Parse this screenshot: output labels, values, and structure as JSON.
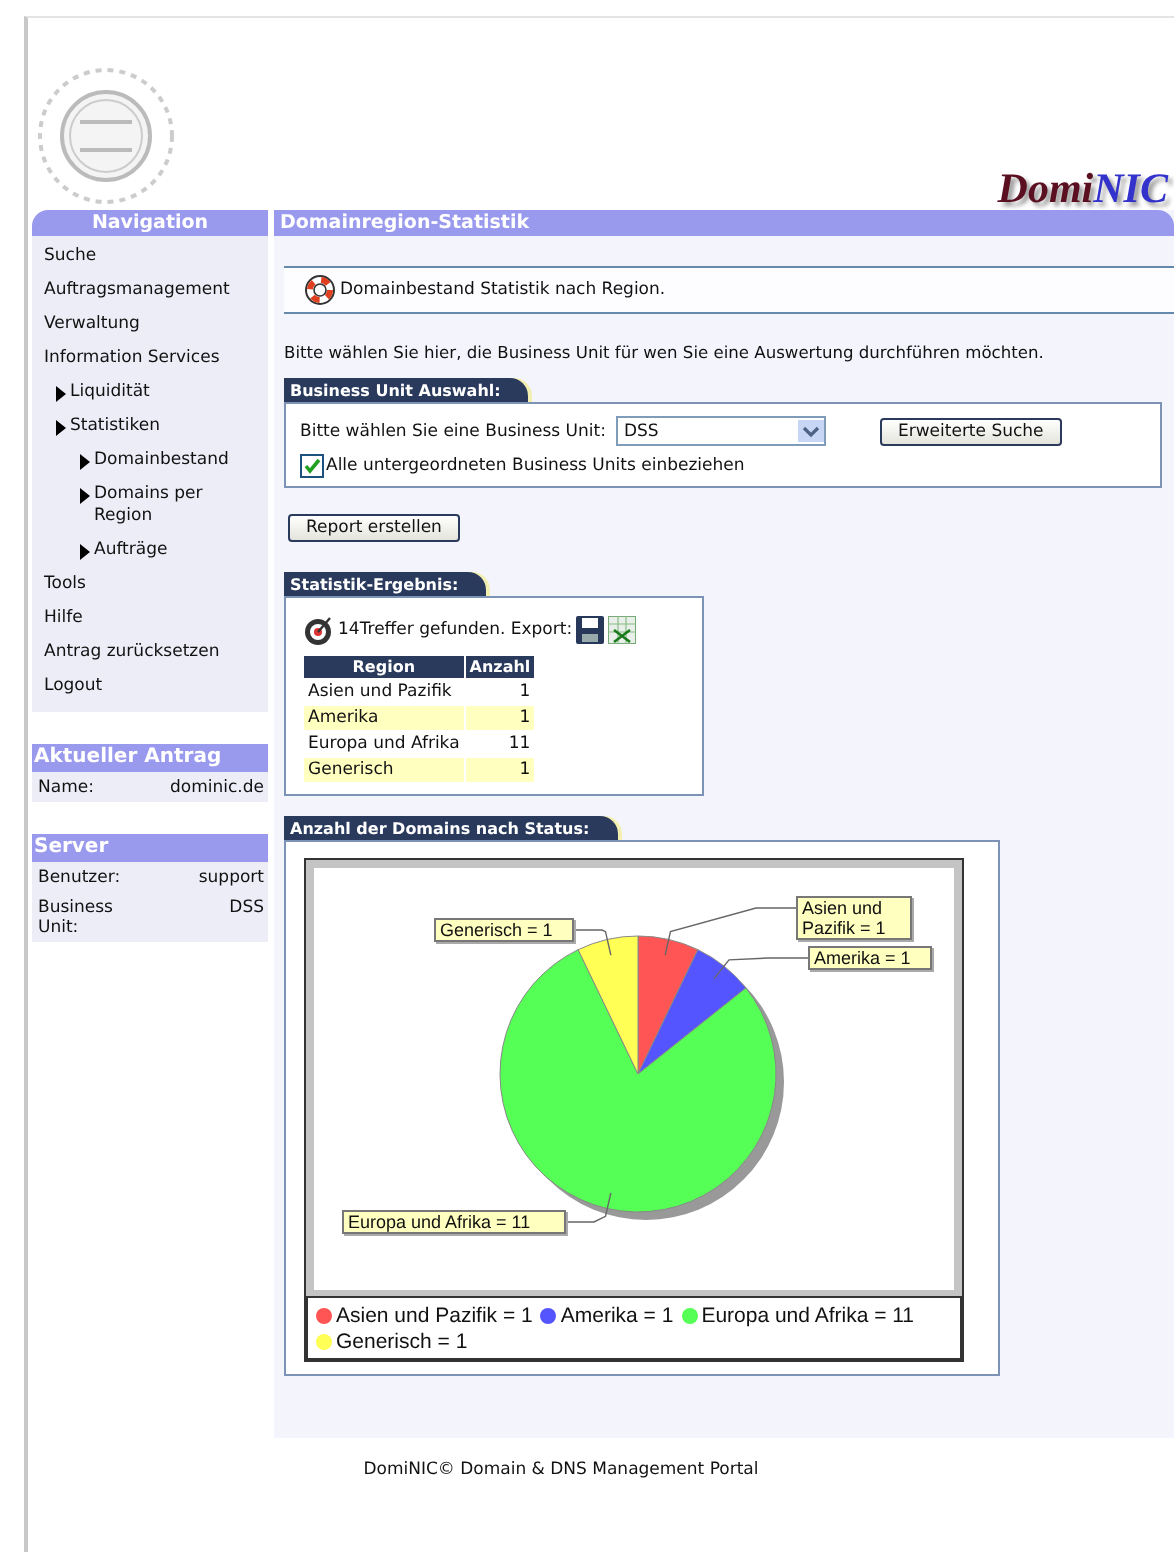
{
  "header": {
    "brand": "Domi",
    "brand_accent": "NIC"
  },
  "sidebar": {
    "title": "Navigation",
    "items": [
      {
        "label": "Suche"
      },
      {
        "label": "Auftragsmanagement"
      },
      {
        "label": "Verwaltung"
      },
      {
        "label": "Information Services",
        "children": [
          {
            "label": "Liquidität"
          },
          {
            "label": "Statistiken",
            "children": [
              {
                "label": "Domainbestand"
              },
              {
                "label": "Domains per Region"
              },
              {
                "label": "Aufträge"
              }
            ]
          }
        ]
      },
      {
        "label": "Tools"
      },
      {
        "label": "Hilfe"
      },
      {
        "label": "Antrag zurücksetzen"
      },
      {
        "label": "Logout"
      }
    ]
  },
  "current_request": {
    "title": "Aktueller Antrag",
    "fields": [
      {
        "label": "Name:",
        "value": "dominic.de"
      }
    ]
  },
  "server": {
    "title": "Server",
    "fields": [
      {
        "label": "Benutzer:",
        "value": "support"
      },
      {
        "label": "Business Unit:",
        "value": "DSS"
      }
    ]
  },
  "main": {
    "title": "Domainregion-Statistik",
    "intro": "Domainbestand Statistik nach Region.",
    "instruction": "Bitte wählen Sie hier, die Business Unit für wen Sie eine Auswertung durchführen möchten.",
    "business_unit": {
      "title": "Business Unit Auswahl:",
      "select_label": "Bitte wählen Sie eine Business Unit:",
      "select_value": "DSS",
      "search_button": "Erweiterte Suche",
      "include_sub": {
        "label": "Alle untergeordneten Business Units einbeziehen",
        "checked": true
      }
    },
    "report_button": "Report erstellen",
    "result": {
      "title": "Statistik-Ergebnis:",
      "summary": "14Treffer gefunden. Export:",
      "columns": [
        "Region",
        "Anzahl"
      ],
      "rows": [
        [
          "Asien und Pazifik",
          "1"
        ],
        [
          "Amerika",
          "1"
        ],
        [
          "Europa und Afrika",
          "11"
        ],
        [
          "Generisch",
          "1"
        ]
      ]
    },
    "chart": {
      "title": "Anzahl der Domains nach Status:",
      "chart_data": {
        "type": "pie",
        "categories": [
          "Asien und Pazifik = 1",
          "Amerika = 1",
          "Europa und Afrika = 11",
          "Generisch = 1"
        ],
        "values": [
          1,
          1,
          11,
          1
        ]
      },
      "slice_labels": [
        "Generisch = 1",
        "Asien und Pazifik = 1",
        "Amerika = 1",
        "Europa und Afrika = 11"
      ],
      "legend": [
        {
          "color": "#ff5555"
        },
        {
          "color": "#5555ff"
        },
        {
          "color": "#55ff55"
        },
        {
          "color": "#ffff55"
        }
      ]
    }
  },
  "footer": "DomiNIC© Domain & DNS Management Portal"
}
